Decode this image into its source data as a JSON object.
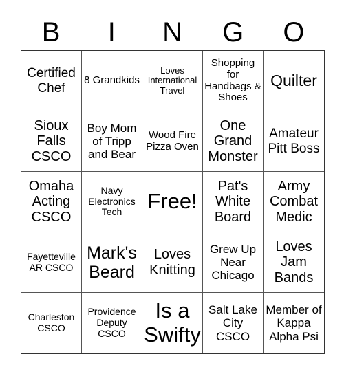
{
  "header": [
    "B",
    "I",
    "N",
    "G",
    "O"
  ],
  "cells": [
    "Certified Chef",
    "8 Grandkids",
    "Loves International Travel",
    "Shopping for Handbags & Shoes",
    "Quilter",
    "Sioux Falls CSCO",
    "Boy Mom of Tripp and Bear",
    "Wood Fire Pizza Oven",
    "One Grand Monster",
    "Amateur Pitt Boss",
    "Omaha Acting CSCO",
    "Navy Electronics Tech",
    "Free!",
    "Pat's White Board",
    "Army Combat Medic",
    "Fayetteville AR CSCO",
    "Mark's Beard",
    "Loves Knitting",
    "Grew Up Near Chicago",
    "Loves Jam Bands",
    "Charleston CSCO",
    "Providence Deputy CSCO",
    "Is a Swifty",
    "Salt Lake City CSCO",
    "Member of Kappa Alpha Psi"
  ]
}
